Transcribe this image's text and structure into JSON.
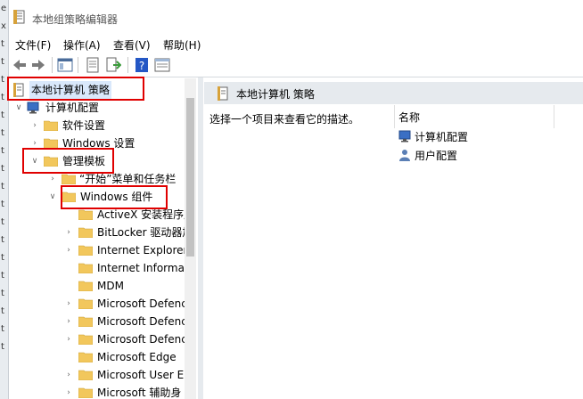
{
  "window": {
    "title": "本地组策略编辑器"
  },
  "menu": {
    "items": [
      "文件(F)",
      "操作(A)",
      "查看(V)",
      "帮助(H)"
    ]
  },
  "left_strip": {
    "chars": [
      "e",
      "x",
      "t",
      "t",
      "t",
      "t",
      "t",
      "t",
      "t",
      "t",
      "t",
      "t",
      "t",
      "t",
      "t",
      "t",
      "t",
      "t",
      "t",
      "t"
    ]
  },
  "tree": {
    "root": "本地计算机 策略",
    "computer_config": "计算机配置",
    "software_settings": "软件设置",
    "windows_settings": "Windows 设置",
    "admin_templates": "管理模板",
    "start_menu": "“开始”菜单和任务栏",
    "windows_components": "Windows 组件",
    "children": [
      "ActiveX 安装程序服",
      "BitLocker 驱动器加",
      "Internet Explorer",
      "Internet Informat",
      "MDM",
      "Microsoft Defenc",
      "Microsoft Defenc",
      "Microsoft Defenc",
      "Microsoft Edge",
      "Microsoft User E",
      "Microsoft 辅助身"
    ]
  },
  "right": {
    "header_title": "本地计算机 策略",
    "description": "选择一个项目来查看它的描述。",
    "column_name": "名称",
    "items": [
      "计算机配置",
      "用户配置"
    ]
  },
  "colors": {
    "highlight_box": "#e00000",
    "folder": "#f2c75c"
  }
}
